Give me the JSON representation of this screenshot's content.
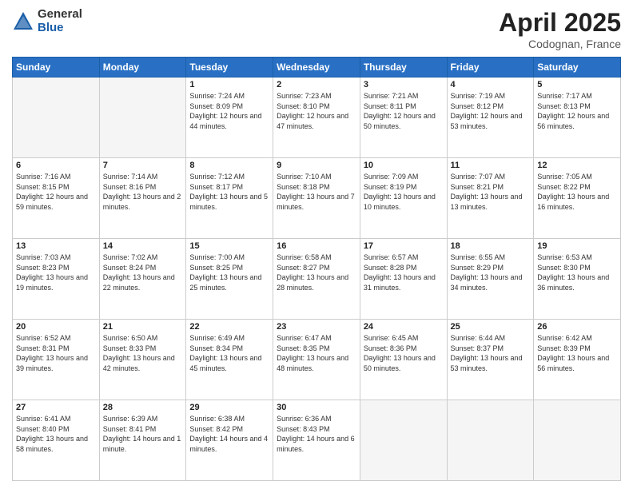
{
  "header": {
    "logo_general": "General",
    "logo_blue": "Blue",
    "title": "April 2025",
    "location": "Codognan, France"
  },
  "weekdays": [
    "Sunday",
    "Monday",
    "Tuesday",
    "Wednesday",
    "Thursday",
    "Friday",
    "Saturday"
  ],
  "weeks": [
    [
      {
        "day": "",
        "empty": true
      },
      {
        "day": "",
        "empty": true
      },
      {
        "day": "1",
        "sunrise": "Sunrise: 7:24 AM",
        "sunset": "Sunset: 8:09 PM",
        "daylight": "Daylight: 12 hours and 44 minutes."
      },
      {
        "day": "2",
        "sunrise": "Sunrise: 7:23 AM",
        "sunset": "Sunset: 8:10 PM",
        "daylight": "Daylight: 12 hours and 47 minutes."
      },
      {
        "day": "3",
        "sunrise": "Sunrise: 7:21 AM",
        "sunset": "Sunset: 8:11 PM",
        "daylight": "Daylight: 12 hours and 50 minutes."
      },
      {
        "day": "4",
        "sunrise": "Sunrise: 7:19 AM",
        "sunset": "Sunset: 8:12 PM",
        "daylight": "Daylight: 12 hours and 53 minutes."
      },
      {
        "day": "5",
        "sunrise": "Sunrise: 7:17 AM",
        "sunset": "Sunset: 8:13 PM",
        "daylight": "Daylight: 12 hours and 56 minutes."
      }
    ],
    [
      {
        "day": "6",
        "sunrise": "Sunrise: 7:16 AM",
        "sunset": "Sunset: 8:15 PM",
        "daylight": "Daylight: 12 hours and 59 minutes."
      },
      {
        "day": "7",
        "sunrise": "Sunrise: 7:14 AM",
        "sunset": "Sunset: 8:16 PM",
        "daylight": "Daylight: 13 hours and 2 minutes."
      },
      {
        "day": "8",
        "sunrise": "Sunrise: 7:12 AM",
        "sunset": "Sunset: 8:17 PM",
        "daylight": "Daylight: 13 hours and 5 minutes."
      },
      {
        "day": "9",
        "sunrise": "Sunrise: 7:10 AM",
        "sunset": "Sunset: 8:18 PM",
        "daylight": "Daylight: 13 hours and 7 minutes."
      },
      {
        "day": "10",
        "sunrise": "Sunrise: 7:09 AM",
        "sunset": "Sunset: 8:19 PM",
        "daylight": "Daylight: 13 hours and 10 minutes."
      },
      {
        "day": "11",
        "sunrise": "Sunrise: 7:07 AM",
        "sunset": "Sunset: 8:21 PM",
        "daylight": "Daylight: 13 hours and 13 minutes."
      },
      {
        "day": "12",
        "sunrise": "Sunrise: 7:05 AM",
        "sunset": "Sunset: 8:22 PM",
        "daylight": "Daylight: 13 hours and 16 minutes."
      }
    ],
    [
      {
        "day": "13",
        "sunrise": "Sunrise: 7:03 AM",
        "sunset": "Sunset: 8:23 PM",
        "daylight": "Daylight: 13 hours and 19 minutes."
      },
      {
        "day": "14",
        "sunrise": "Sunrise: 7:02 AM",
        "sunset": "Sunset: 8:24 PM",
        "daylight": "Daylight: 13 hours and 22 minutes."
      },
      {
        "day": "15",
        "sunrise": "Sunrise: 7:00 AM",
        "sunset": "Sunset: 8:25 PM",
        "daylight": "Daylight: 13 hours and 25 minutes."
      },
      {
        "day": "16",
        "sunrise": "Sunrise: 6:58 AM",
        "sunset": "Sunset: 8:27 PM",
        "daylight": "Daylight: 13 hours and 28 minutes."
      },
      {
        "day": "17",
        "sunrise": "Sunrise: 6:57 AM",
        "sunset": "Sunset: 8:28 PM",
        "daylight": "Daylight: 13 hours and 31 minutes."
      },
      {
        "day": "18",
        "sunrise": "Sunrise: 6:55 AM",
        "sunset": "Sunset: 8:29 PM",
        "daylight": "Daylight: 13 hours and 34 minutes."
      },
      {
        "day": "19",
        "sunrise": "Sunrise: 6:53 AM",
        "sunset": "Sunset: 8:30 PM",
        "daylight": "Daylight: 13 hours and 36 minutes."
      }
    ],
    [
      {
        "day": "20",
        "sunrise": "Sunrise: 6:52 AM",
        "sunset": "Sunset: 8:31 PM",
        "daylight": "Daylight: 13 hours and 39 minutes."
      },
      {
        "day": "21",
        "sunrise": "Sunrise: 6:50 AM",
        "sunset": "Sunset: 8:33 PM",
        "daylight": "Daylight: 13 hours and 42 minutes."
      },
      {
        "day": "22",
        "sunrise": "Sunrise: 6:49 AM",
        "sunset": "Sunset: 8:34 PM",
        "daylight": "Daylight: 13 hours and 45 minutes."
      },
      {
        "day": "23",
        "sunrise": "Sunrise: 6:47 AM",
        "sunset": "Sunset: 8:35 PM",
        "daylight": "Daylight: 13 hours and 48 minutes."
      },
      {
        "day": "24",
        "sunrise": "Sunrise: 6:45 AM",
        "sunset": "Sunset: 8:36 PM",
        "daylight": "Daylight: 13 hours and 50 minutes."
      },
      {
        "day": "25",
        "sunrise": "Sunrise: 6:44 AM",
        "sunset": "Sunset: 8:37 PM",
        "daylight": "Daylight: 13 hours and 53 minutes."
      },
      {
        "day": "26",
        "sunrise": "Sunrise: 6:42 AM",
        "sunset": "Sunset: 8:39 PM",
        "daylight": "Daylight: 13 hours and 56 minutes."
      }
    ],
    [
      {
        "day": "27",
        "sunrise": "Sunrise: 6:41 AM",
        "sunset": "Sunset: 8:40 PM",
        "daylight": "Daylight: 13 hours and 58 minutes."
      },
      {
        "day": "28",
        "sunrise": "Sunrise: 6:39 AM",
        "sunset": "Sunset: 8:41 PM",
        "daylight": "Daylight: 14 hours and 1 minute."
      },
      {
        "day": "29",
        "sunrise": "Sunrise: 6:38 AM",
        "sunset": "Sunset: 8:42 PM",
        "daylight": "Daylight: 14 hours and 4 minutes."
      },
      {
        "day": "30",
        "sunrise": "Sunrise: 6:36 AM",
        "sunset": "Sunset: 8:43 PM",
        "daylight": "Daylight: 14 hours and 6 minutes."
      },
      {
        "day": "",
        "empty": true
      },
      {
        "day": "",
        "empty": true
      },
      {
        "day": "",
        "empty": true
      }
    ]
  ]
}
